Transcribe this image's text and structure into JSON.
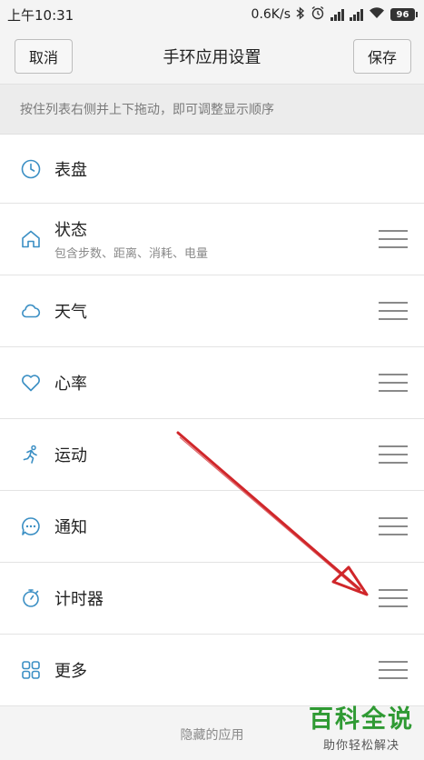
{
  "status_bar": {
    "time": "上午10:31",
    "speed": "0.6K/s",
    "battery": "96",
    "icons": [
      "bluetooth-icon",
      "alarm-icon",
      "signal-icon",
      "signal-icon",
      "wifi-icon",
      "battery-icon"
    ]
  },
  "header": {
    "cancel_label": "取消",
    "title": "手环应用设置",
    "save_label": "保存"
  },
  "hint": "按住列表右侧并上下拖动，即可调整显示顺序",
  "items": [
    {
      "label": "表盘",
      "icon": "clock-icon",
      "draggable": false
    },
    {
      "label": "状态",
      "sub": "包含步数、距离、消耗、电量",
      "icon": "home-icon",
      "draggable": true
    },
    {
      "label": "天气",
      "icon": "cloud-icon",
      "draggable": true
    },
    {
      "label": "心率",
      "icon": "heart-icon",
      "draggable": true
    },
    {
      "label": "运动",
      "icon": "running-icon",
      "draggable": true
    },
    {
      "label": "通知",
      "icon": "chat-bubble-icon",
      "draggable": true
    },
    {
      "label": "计时器",
      "icon": "stopwatch-icon",
      "draggable": true
    },
    {
      "label": "更多",
      "icon": "grid-icon",
      "draggable": true
    }
  ],
  "hidden_section": "隐藏的应用",
  "watermark": {
    "main": "百科全说",
    "sub": "助你轻松解决"
  },
  "colors": {
    "icon_accent": "#3b8fc4",
    "arrow": "#d0262a",
    "watermark": "#2f9a33"
  }
}
